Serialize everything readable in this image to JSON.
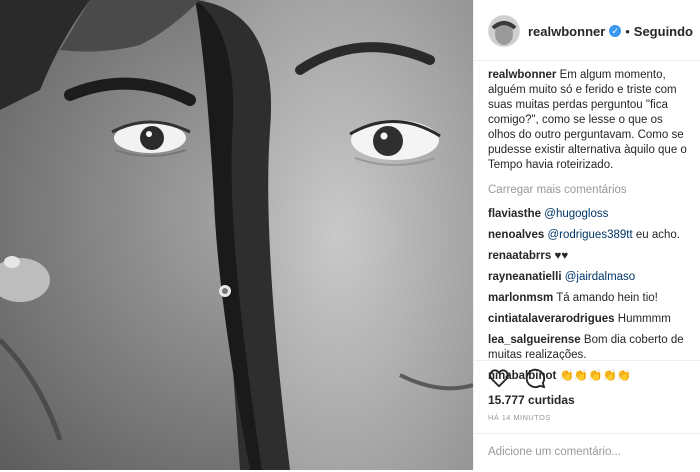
{
  "post": {
    "photo_alt": "Selfie em preto e branco de um casal, rosto a rosto",
    "author": {
      "username": "realwbonner",
      "verified_icon": "verified-badge-icon",
      "follow_separator": "•",
      "follow_status": "Seguindo"
    },
    "caption": {
      "username": "realwbonner",
      "text": "Em algum momento, alguém muito só e ferido e triste com suas muitas perdas perguntou \"fica comigo?\", como se lesse o que os olhos do outro perguntavam. Como se pudesse existir alternativa àquilo que o Tempo havia roteirizado."
    },
    "load_more": "Carregar mais comentários",
    "comments": [
      {
        "user": "flaviasthe",
        "mention": "@hugogloss",
        "text": ""
      },
      {
        "user": "nenoalves",
        "mention": "@rodrigues389tt",
        "text": "eu acho."
      },
      {
        "user": "renaatabrrs",
        "mention": "",
        "text": "♥♥"
      },
      {
        "user": "rayneanatielli",
        "mention": "@jairdalmaso",
        "text": ""
      },
      {
        "user": "marlonmsm",
        "mention": "",
        "text": "Tá amando hein tio!"
      },
      {
        "user": "cintiatalaverarodrigues",
        "mention": "",
        "text": "Hummmm"
      },
      {
        "user": "lea_salgueirense",
        "mention": "",
        "text": "Bom dia coberto de muitas realizações."
      },
      {
        "user": "ninabalbinot",
        "mention": "",
        "text": "👏👏👏👏👏"
      }
    ],
    "likes": "15.777 curtidas",
    "time_ago": "HÁ 14 MINUTOS",
    "add_comment_placeholder": "Adicione um comentário..."
  }
}
